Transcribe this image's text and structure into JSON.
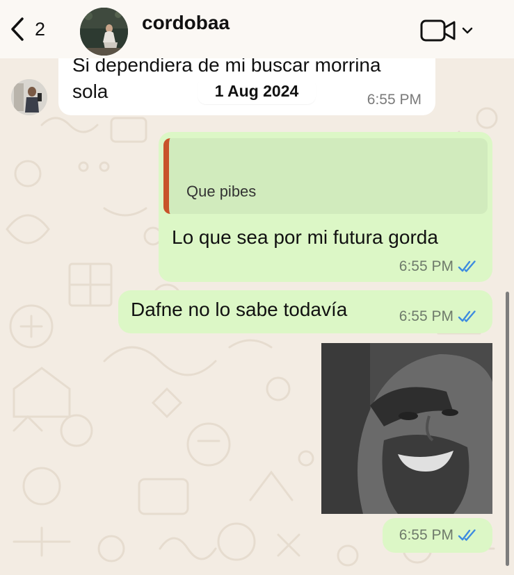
{
  "header": {
    "back_count": "2",
    "contact_name": "cordobaa"
  },
  "messages": {
    "incoming": {
      "line1": "Si dependiera de mi buscar morrina",
      "line2": "sola",
      "time": "6:55 PM"
    },
    "date_separator": "1 Aug 2024",
    "reply": {
      "quoted_text": "Que pibes",
      "text": "Lo que sea por mi futura gorda",
      "time": "6:55 PM",
      "status": "read"
    },
    "second": {
      "text": "Dafne no lo sabe todavía",
      "time": "6:55 PM",
      "status": "read"
    },
    "image": {
      "time": "6:55 PM",
      "status": "read"
    }
  },
  "colors": {
    "wallpaper": "#f3ece3",
    "outgoing_bubble": "#dcf7c6",
    "quote_background": "#d1ebbd",
    "quote_accent": "#c8532a",
    "read_ticks": "#3d8be0"
  },
  "icons": {
    "back": "chevron-left-icon",
    "video_call": "video-camera-icon",
    "dropdown": "chevron-down-icon",
    "read_receipt": "double-check-icon"
  }
}
